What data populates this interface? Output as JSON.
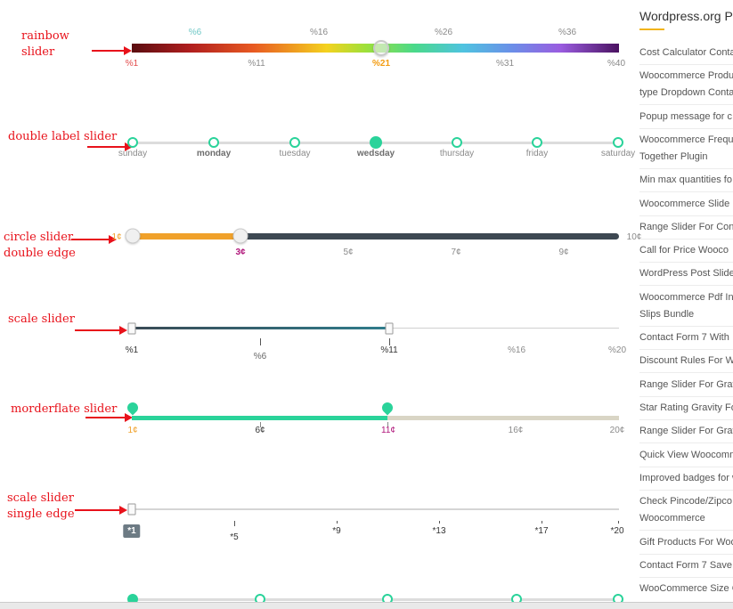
{
  "annotations": {
    "rainbow": [
      "rainbow",
      "slider"
    ],
    "double_label": "double label slider",
    "circle": [
      "circle slider",
      "double edge"
    ],
    "scale": "scale slider",
    "morderflate": "morderflate slider",
    "scale_single": [
      "scale slider",
      "single edge"
    ]
  },
  "rainbow_slider": {
    "top_labels": [
      "%6",
      "%16",
      "%26",
      "%36"
    ],
    "bottom_labels": [
      "%1",
      "%11",
      "%21",
      "%31",
      "%40"
    ],
    "value": "%21",
    "colors": {
      "top": "#6fc8c6",
      "active": "#f39c12",
      "first": "#e24a4a"
    }
  },
  "double_label_slider": {
    "labels": [
      "sunday",
      "monday",
      "tuesday",
      "wedsday",
      "thursday",
      "friday",
      "saturday"
    ],
    "bold": [
      "monday",
      "wedsday"
    ],
    "selected": "wedsday"
  },
  "circle_slider": {
    "labels": [
      "1¢",
      "3¢",
      "5¢",
      "7¢",
      "9¢",
      "10¢"
    ],
    "from": "1¢",
    "to": "3¢",
    "colors": {
      "fill": "#f0a12a",
      "track": "#3d4852"
    }
  },
  "scale_slider": {
    "labels": [
      "%1",
      "%6",
      "%11",
      "%16",
      "%20"
    ],
    "from": "%1",
    "to": "%11"
  },
  "morderflate_slider": {
    "labels": [
      "1¢",
      "6¢",
      "11¢",
      "16¢",
      "20¢"
    ],
    "from": "1¢",
    "to": "11¢",
    "colors": {
      "fill": "#2ad39a",
      "rest": "#d9d5c5"
    }
  },
  "scale_single_slider": {
    "badge": "*1",
    "labels": [
      "*5",
      "*9",
      "*13",
      "*17",
      "*20"
    ]
  },
  "sidebar": {
    "title": "Wordpress.org Plugins",
    "items": [
      "Cost Calculator Contact",
      "Woocommerce Product",
      "type Dropdown Contact",
      "Popup message for c",
      "Woocommerce Frequ",
      "Together Plugin",
      "Min max quantities fo",
      "Woocommerce Slide",
      "Range Slider For Con",
      "Call for Price Wooco",
      "WordPress Post Slide",
      "Woocommerce Pdf In",
      "Slips Bundle",
      "Contact Form 7 With",
      "Discount Rules For W",
      "Range Slider For Grav",
      "Star Rating Gravity Fo",
      "Range Slider For Grav",
      "Quick View Woocomm",
      "Improved badges for w",
      "Check Pincode/Zipco",
      "Woocommerce",
      "Gift Products For Woo",
      "Contact Form 7 Save",
      "WooCommerce Size C"
    ]
  }
}
